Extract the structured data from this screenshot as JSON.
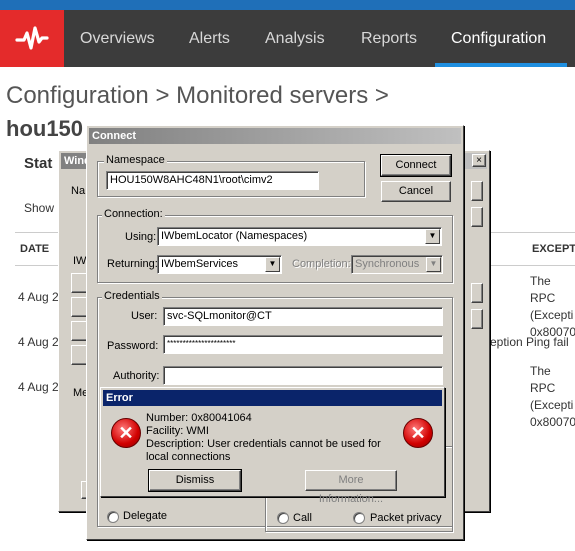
{
  "nav": {
    "items": [
      {
        "label": "Overviews"
      },
      {
        "label": "Alerts"
      },
      {
        "label": "Analysis"
      },
      {
        "label": "Reports"
      },
      {
        "label": "Configuration"
      }
    ]
  },
  "breadcrumb": {
    "part1": "Configuration",
    "sep1": ">",
    "part2": "Monitored servers",
    "sep2": ">",
    "server": "hou150"
  },
  "background": {
    "stat": "Stat",
    "show": "Show",
    "date_header": "DATE",
    "exception_header": "EXCEPT",
    "row_dates": [
      "4 Aug 2",
      "4 Aug 2",
      "4 Aug 2"
    ],
    "row1_text": [
      "The RPC",
      "(Excepti",
      "0x80070"
    ],
    "row2_text": "eption Ping fail",
    "row3_text": [
      "The RPC",
      "(Excepti",
      "0x80070"
    ],
    "win_label": "Wind",
    "na": "Na",
    "me": "Me",
    "iw": "IW"
  },
  "connect": {
    "title": "Connect",
    "namespace_label": "Namespace",
    "namespace_value": "HOU150W8AHC48N1\\root\\cimv2",
    "connect_btn": "Connect",
    "cancel_btn": "Cancel",
    "connection_label": "Connection:",
    "using_label": "Using:",
    "using_value": "IWbemLocator (Namespaces)",
    "returning_label": "Returning:",
    "returning_value": "IWbemServices",
    "completion_label": "Completion:",
    "completion_value": "Synchronous",
    "credentials_label": "Credentials",
    "user_label": "User:",
    "user_value": "svc-SQLmonitor@CT",
    "password_label": "Password:",
    "password_value": "**********************",
    "authority_label": "Authority:",
    "authority_value": "",
    "delegate_label": "Delegate",
    "call_label": "Call",
    "packet_label": "Packet privacy"
  },
  "error": {
    "title": "Error",
    "number": "Number: 0x80041064",
    "facility": "Facility: WMI",
    "description": "Description: User credentials cannot be used for local connections",
    "dismiss_btn": "Dismiss",
    "more_btn": "More Information..."
  }
}
